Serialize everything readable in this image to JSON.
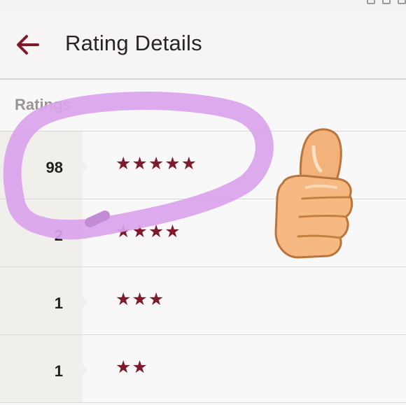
{
  "header": {
    "title": "Rating Details"
  },
  "section": {
    "label": "Ratings"
  },
  "ratings": [
    {
      "count": "98",
      "stars": "★★★★★",
      "star_rating": 5
    },
    {
      "count": "2",
      "stars": "★★★★",
      "star_rating": 4
    },
    {
      "count": "1",
      "stars": "★★★",
      "star_rating": 3
    },
    {
      "count": "1",
      "stars": "★★",
      "star_rating": 2
    }
  ],
  "icons": {
    "back": "arrow-left-icon",
    "overlay_emoji": "thumbs-up-icon"
  },
  "colors": {
    "accent": "#7d1a2b",
    "highlight_stroke": "#d9a3ec",
    "thumb": "#f3b27a"
  }
}
